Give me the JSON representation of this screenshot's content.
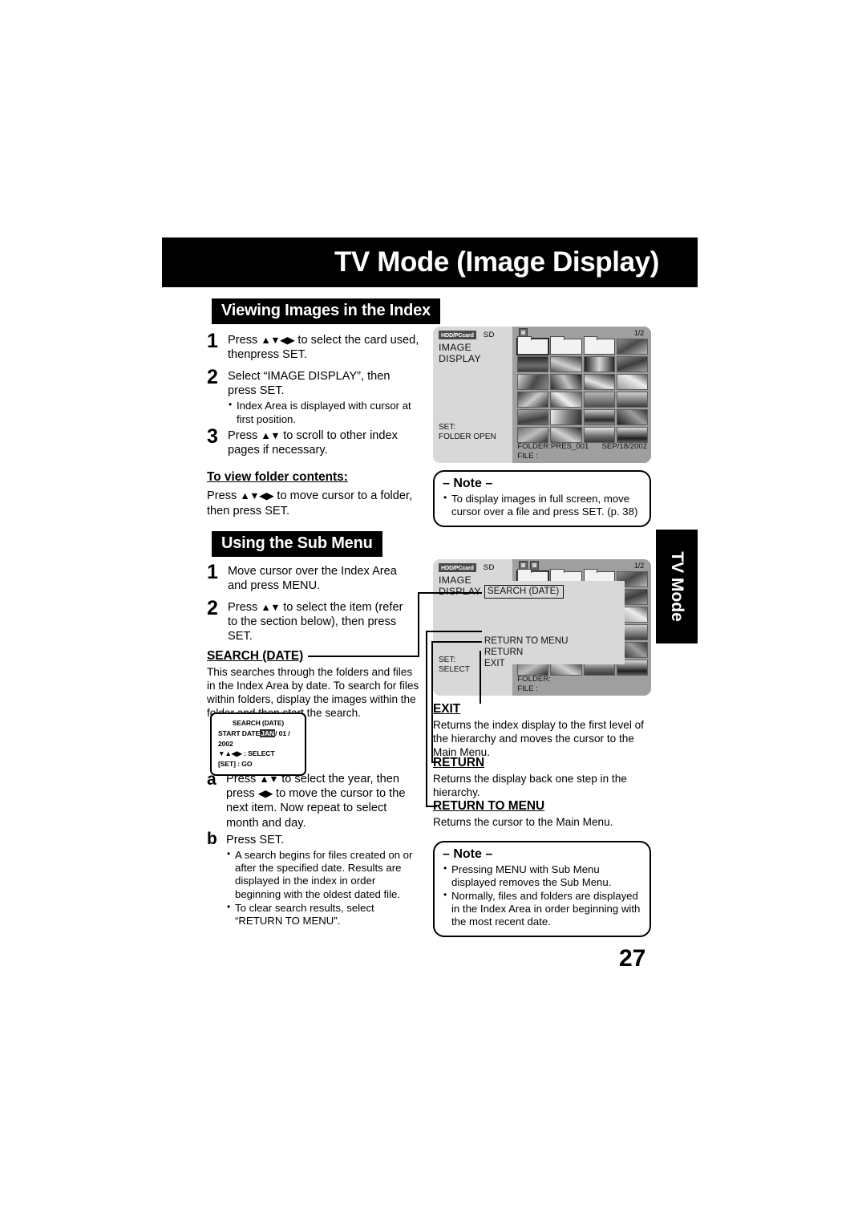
{
  "page": {
    "title": "TV Mode (Image Display)",
    "number": "27",
    "side_tab": "TV Mode"
  },
  "sections": {
    "viewing": {
      "heading": "Viewing Images in the Index",
      "steps": [
        {
          "num": "1",
          "text_1": "Press",
          "arrows": "▲▼◀▶",
          "text_2": "to select the card used, then",
          "text_3": "press SET",
          "text_4": "."
        },
        {
          "num": "2",
          "text_1": "Select “IMAGE DISPLAY”, then press SET.",
          "bullets": [
            "Index Area is displayed with cursor at first position."
          ]
        },
        {
          "num": "3",
          "text_1": "Press",
          "arrows": "▲▼",
          "text_2": "to scroll to other index pages if necessary."
        }
      ],
      "folder_contents_head": "To view folder contents:",
      "folder_contents_body_1": "Press",
      "folder_contents_arrows": "▲▼◀▶",
      "folder_contents_body_2": "to move cursor to a folder, then press SET."
    },
    "submenu": {
      "heading": "Using the Sub Menu",
      "steps": [
        {
          "num": "1",
          "text_1": "Move cursor over the Index Area and press MENU."
        },
        {
          "num": "2",
          "text_1": "Press",
          "arrows": "▲▼",
          "text_2": "to select the item (refer to the section below), then",
          "text_3": "press SET",
          "text_4": "."
        }
      ]
    },
    "search_date": {
      "heading": "SEARCH (DATE)",
      "body": "This searches through the folders and files in the Index Area by date. To search for files within folders, display the images within the folder and then start the search.",
      "steps": [
        {
          "letter": "a",
          "text_1": "Press",
          "arrows_1": "▲▼",
          "text_2": "to select the year, then",
          "text_3": "press",
          "arrows_2": "◀▶",
          "text_4": "to move the cursor to the next item. Now repeat to select month and day."
        },
        {
          "letter": "b",
          "text_1": "Press SET",
          "text_2": ".",
          "bullets": [
            "A search begins for files created on or after the specified date. Results are displayed in the index in order beginning with the oldest dated file.",
            "To clear search results, select “RETURN TO MENU”."
          ]
        }
      ]
    },
    "exit": {
      "heading": "EXIT",
      "body": "Returns the index display to the first level of the hierarchy and moves the cursor to the Main Menu."
    },
    "return": {
      "heading": "RETURN",
      "body": "Returns the display back one step in the hierarchy."
    },
    "return_to_menu": {
      "heading": "RETURN TO MENU",
      "body": "Returns the cursor to the Main Menu."
    }
  },
  "notes": {
    "top": {
      "title": "– Note –",
      "bullets": [
        "To display images in full screen, move cursor over a file and press SET. (p. 38)"
      ]
    },
    "bottom": {
      "title": "– Note –",
      "bullets": [
        "Pressing MENU with Sub Menu displayed removes the Sub Menu.",
        "Normally, files and folders are displayed in the Index Area in order beginning with the most recent date."
      ]
    }
  },
  "tv_screen_1": {
    "tab_hdd": "HDD/PCcard",
    "tab_sd": "SD",
    "mode_label": "IMAGE DISPLAY",
    "page_indicator": "1/2",
    "set_line_1": "SET:",
    "set_line_2": "FOLDER OPEN",
    "folder_label": "FOLDER:PRES_001",
    "date_label": "SEP/18/2002",
    "file_label": "FILE    :"
  },
  "tv_screen_2": {
    "tab_hdd": "HDD/PCcard",
    "tab_sd": "SD",
    "mode_label": "IMAGE DISPLAY",
    "page_indicator": "1/2",
    "menu_search": "SEARCH (DATE)",
    "menu_return_to_menu": "RETURN TO MENU",
    "menu_return": "RETURN",
    "menu_exit": "EXIT",
    "set_line_1": "SET:",
    "set_line_2": "SELECT",
    "folder_label": "FOLDER:",
    "file_label": "FILE    :"
  },
  "osd_search_dialog": {
    "title": "SEARCH (DATE)",
    "start_date_label": "START DATE",
    "month": "JAN",
    "day_year": "/ 01 / 2002",
    "select_line": "▼▲◀▶ : SELECT",
    "go_line": "[SET] : GO"
  },
  "colors": {
    "bar_black": "#000000",
    "tv_panel": "#d8d8d8",
    "tv_grid": "#9f9f9f"
  }
}
